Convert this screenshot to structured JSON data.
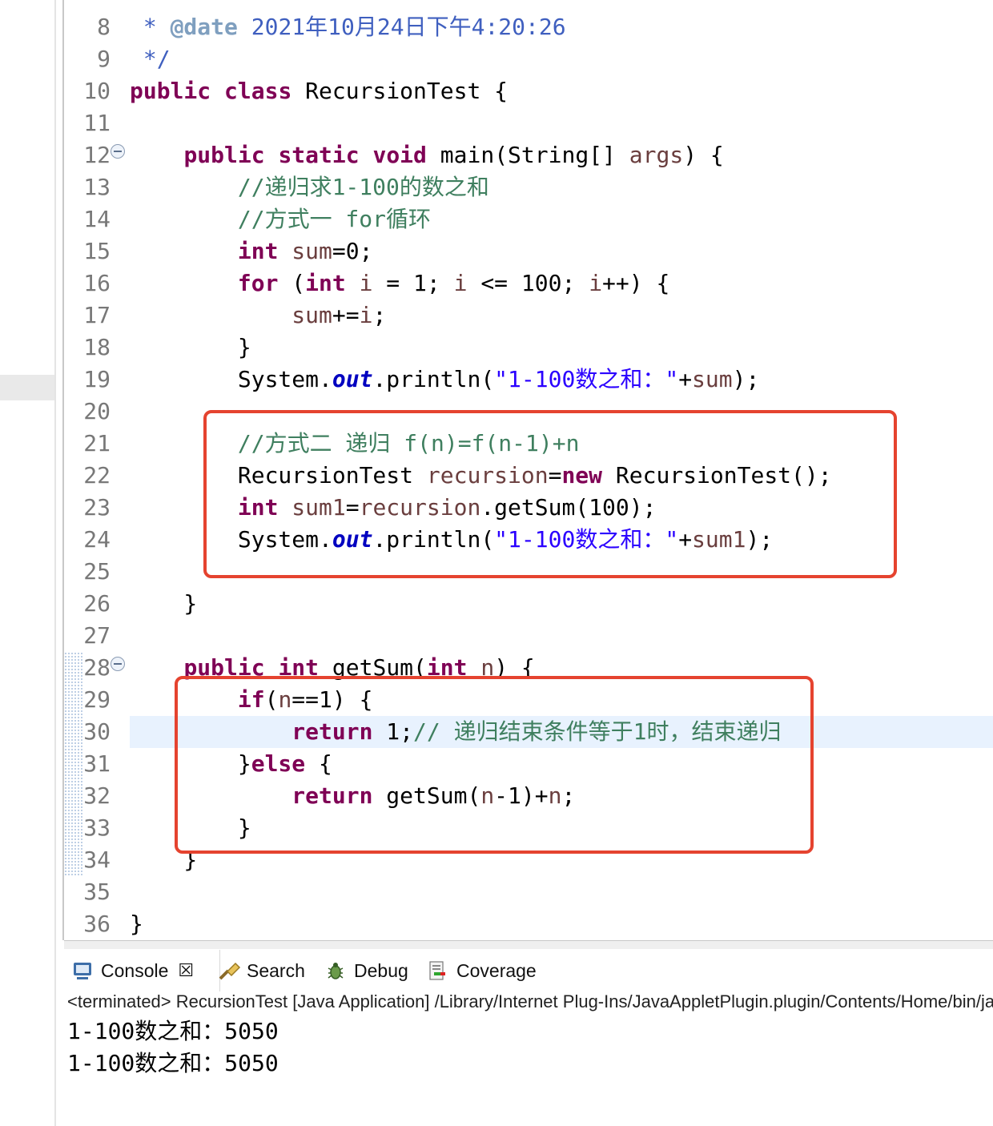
{
  "line_numbers": [
    "8",
    "9",
    "10",
    "11",
    "12",
    "13",
    "14",
    "15",
    "16",
    "17",
    "18",
    "19",
    "20",
    "21",
    "22",
    "23",
    "24",
    "25",
    "26",
    "27",
    "28",
    "29",
    "30",
    "31",
    "32",
    "33",
    "34",
    "35",
    "36"
  ],
  "code": {
    "l8": {
      "star": " * ",
      "tag": "@date",
      "text": " 2021年10月24日下午4:20:26"
    },
    "l9": {
      "text": " */"
    },
    "l10": {
      "kw1": "public",
      "kw2": "class",
      "rest": " RecursionTest {"
    },
    "l12": {
      "indent": "    ",
      "kw1": "public",
      "kw2": "static",
      "kw3": "void",
      "rest1": " main(String[] ",
      "var": "args",
      "rest2": ") {"
    },
    "l13": {
      "indent": "        ",
      "comment": "//递归求1-100的数之和"
    },
    "l14": {
      "indent": "        ",
      "comment": "//方式一 for循环"
    },
    "l15": {
      "indent": "        ",
      "kw": "int",
      "var": "sum",
      "rest": "=0;"
    },
    "l16": {
      "indent": "        ",
      "kw1": "for",
      "p1": " (",
      "kw2": "int",
      "v1": "i",
      "p2": " = 1; ",
      "v2": "i",
      "p3": " <= 100; ",
      "v3": "i",
      "p4": "++) {"
    },
    "l17": {
      "indent": "            ",
      "v1": "sum",
      "p1": "+=",
      "v2": "i",
      "p2": ";"
    },
    "l18": {
      "text": "        }"
    },
    "l19": {
      "indent": "        ",
      "p1": "System.",
      "field": "out",
      "p2": ".println(",
      "str": "\"1-100数之和：\"",
      "p3": "+",
      "var": "sum",
      "p4": ");"
    },
    "l21": {
      "indent": "        ",
      "comment": "//方式二 递归 f(n)=f(n-1)+n"
    },
    "l22": {
      "indent": "        ",
      "p1": "RecursionTest ",
      "var": "recursion",
      "p2": "=",
      "kw": "new",
      "p3": " RecursionTest();"
    },
    "l23": {
      "indent": "        ",
      "kw": "int",
      "v1": "sum1",
      "p1": "=",
      "v2": "recursion",
      "p2": ".getSum(100);"
    },
    "l24": {
      "indent": "        ",
      "p1": "System.",
      "field": "out",
      "p2": ".println(",
      "str": "\"1-100数之和：\"",
      "p3": "+",
      "var": "sum1",
      "p4": ");"
    },
    "l26": {
      "text": "    }"
    },
    "l28": {
      "indent": "    ",
      "kw1": "public",
      "kw2": "int",
      "p1": " getSum(",
      "kw3": "int",
      "var": "n",
      "p2": ") {"
    },
    "l29": {
      "indent": "        ",
      "kw": "if",
      "p1": "(",
      "var": "n",
      "p2": "==1) {"
    },
    "l30": {
      "indent": "            ",
      "kw": "return",
      "p1": " 1;",
      "comment": "// 递归结束条件等于1时，结束递归"
    },
    "l31": {
      "indent": "        ",
      "p1": "}",
      "kw": "else",
      "p2": " {"
    },
    "l32": {
      "indent": "            ",
      "kw": "return",
      "p1": " getSum(",
      "v1": "n",
      "p2": "-1)+",
      "v2": "n",
      "p3": ";"
    },
    "l33": {
      "text": "        }"
    },
    "l34": {
      "text": "    }"
    },
    "l36": {
      "text": "}"
    }
  },
  "console": {
    "tabs": [
      {
        "label": "Console",
        "icon": "console-icon"
      },
      {
        "label": "Search",
        "icon": "search-icon"
      },
      {
        "label": "Debug",
        "icon": "debug-icon"
      },
      {
        "label": "Coverage",
        "icon": "coverage-icon"
      }
    ],
    "close_glyph": "☒",
    "info": "<terminated> RecursionTest [Java Application] /Library/Internet Plug-Ins/JavaAppletPlugin.plugin/Contents/Home/bin/java",
    "output": [
      "1-100数之和：5050",
      "1-100数之和：5050"
    ]
  },
  "colors": {
    "annotation_box": "#e5432f",
    "keyword": "#7f0055",
    "comment": "#3f7f5f",
    "string": "#2a00ff",
    "current_line": "#e8f2fe"
  }
}
